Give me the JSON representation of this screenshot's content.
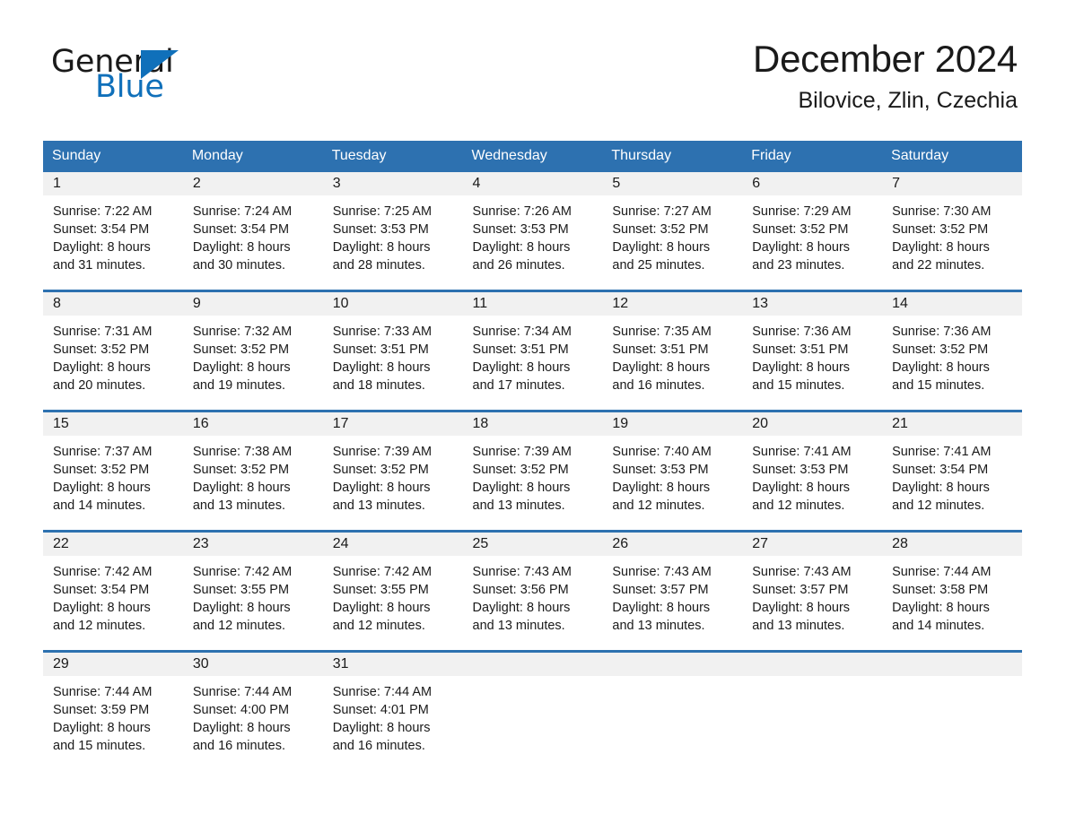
{
  "brand": {
    "name_part1": "General",
    "name_part2": "Blue",
    "accent_color": "#1070ba"
  },
  "header": {
    "month_title": "December 2024",
    "location": "Bilovice, Zlin, Czechia"
  },
  "theme": {
    "header_row_bg": "#2d71b0",
    "daynum_band_bg": "#f1f1f1",
    "row_divider": "#2d71b0",
    "text": "#1a1a1a"
  },
  "weekday_headers": [
    "Sunday",
    "Monday",
    "Tuesday",
    "Wednesday",
    "Thursday",
    "Friday",
    "Saturday"
  ],
  "weeks": [
    {
      "days": [
        {
          "date": "1",
          "sunrise": "Sunrise: 7:22 AM",
          "sunset": "Sunset: 3:54 PM",
          "daylight_line1": "Daylight: 8 hours",
          "daylight_line2": "and 31 minutes."
        },
        {
          "date": "2",
          "sunrise": "Sunrise: 7:24 AM",
          "sunset": "Sunset: 3:54 PM",
          "daylight_line1": "Daylight: 8 hours",
          "daylight_line2": "and 30 minutes."
        },
        {
          "date": "3",
          "sunrise": "Sunrise: 7:25 AM",
          "sunset": "Sunset: 3:53 PM",
          "daylight_line1": "Daylight: 8 hours",
          "daylight_line2": "and 28 minutes."
        },
        {
          "date": "4",
          "sunrise": "Sunrise: 7:26 AM",
          "sunset": "Sunset: 3:53 PM",
          "daylight_line1": "Daylight: 8 hours",
          "daylight_line2": "and 26 minutes."
        },
        {
          "date": "5",
          "sunrise": "Sunrise: 7:27 AM",
          "sunset": "Sunset: 3:52 PM",
          "daylight_line1": "Daylight: 8 hours",
          "daylight_line2": "and 25 minutes."
        },
        {
          "date": "6",
          "sunrise": "Sunrise: 7:29 AM",
          "sunset": "Sunset: 3:52 PM",
          "daylight_line1": "Daylight: 8 hours",
          "daylight_line2": "and 23 minutes."
        },
        {
          "date": "7",
          "sunrise": "Sunrise: 7:30 AM",
          "sunset": "Sunset: 3:52 PM",
          "daylight_line1": "Daylight: 8 hours",
          "daylight_line2": "and 22 minutes."
        }
      ]
    },
    {
      "days": [
        {
          "date": "8",
          "sunrise": "Sunrise: 7:31 AM",
          "sunset": "Sunset: 3:52 PM",
          "daylight_line1": "Daylight: 8 hours",
          "daylight_line2": "and 20 minutes."
        },
        {
          "date": "9",
          "sunrise": "Sunrise: 7:32 AM",
          "sunset": "Sunset: 3:52 PM",
          "daylight_line1": "Daylight: 8 hours",
          "daylight_line2": "and 19 minutes."
        },
        {
          "date": "10",
          "sunrise": "Sunrise: 7:33 AM",
          "sunset": "Sunset: 3:51 PM",
          "daylight_line1": "Daylight: 8 hours",
          "daylight_line2": "and 18 minutes."
        },
        {
          "date": "11",
          "sunrise": "Sunrise: 7:34 AM",
          "sunset": "Sunset: 3:51 PM",
          "daylight_line1": "Daylight: 8 hours",
          "daylight_line2": "and 17 minutes."
        },
        {
          "date": "12",
          "sunrise": "Sunrise: 7:35 AM",
          "sunset": "Sunset: 3:51 PM",
          "daylight_line1": "Daylight: 8 hours",
          "daylight_line2": "and 16 minutes."
        },
        {
          "date": "13",
          "sunrise": "Sunrise: 7:36 AM",
          "sunset": "Sunset: 3:51 PM",
          "daylight_line1": "Daylight: 8 hours",
          "daylight_line2": "and 15 minutes."
        },
        {
          "date": "14",
          "sunrise": "Sunrise: 7:36 AM",
          "sunset": "Sunset: 3:52 PM",
          "daylight_line1": "Daylight: 8 hours",
          "daylight_line2": "and 15 minutes."
        }
      ]
    },
    {
      "days": [
        {
          "date": "15",
          "sunrise": "Sunrise: 7:37 AM",
          "sunset": "Sunset: 3:52 PM",
          "daylight_line1": "Daylight: 8 hours",
          "daylight_line2": "and 14 minutes."
        },
        {
          "date": "16",
          "sunrise": "Sunrise: 7:38 AM",
          "sunset": "Sunset: 3:52 PM",
          "daylight_line1": "Daylight: 8 hours",
          "daylight_line2": "and 13 minutes."
        },
        {
          "date": "17",
          "sunrise": "Sunrise: 7:39 AM",
          "sunset": "Sunset: 3:52 PM",
          "daylight_line1": "Daylight: 8 hours",
          "daylight_line2": "and 13 minutes."
        },
        {
          "date": "18",
          "sunrise": "Sunrise: 7:39 AM",
          "sunset": "Sunset: 3:52 PM",
          "daylight_line1": "Daylight: 8 hours",
          "daylight_line2": "and 13 minutes."
        },
        {
          "date": "19",
          "sunrise": "Sunrise: 7:40 AM",
          "sunset": "Sunset: 3:53 PM",
          "daylight_line1": "Daylight: 8 hours",
          "daylight_line2": "and 12 minutes."
        },
        {
          "date": "20",
          "sunrise": "Sunrise: 7:41 AM",
          "sunset": "Sunset: 3:53 PM",
          "daylight_line1": "Daylight: 8 hours",
          "daylight_line2": "and 12 minutes."
        },
        {
          "date": "21",
          "sunrise": "Sunrise: 7:41 AM",
          "sunset": "Sunset: 3:54 PM",
          "daylight_line1": "Daylight: 8 hours",
          "daylight_line2": "and 12 minutes."
        }
      ]
    },
    {
      "days": [
        {
          "date": "22",
          "sunrise": "Sunrise: 7:42 AM",
          "sunset": "Sunset: 3:54 PM",
          "daylight_line1": "Daylight: 8 hours",
          "daylight_line2": "and 12 minutes."
        },
        {
          "date": "23",
          "sunrise": "Sunrise: 7:42 AM",
          "sunset": "Sunset: 3:55 PM",
          "daylight_line1": "Daylight: 8 hours",
          "daylight_line2": "and 12 minutes."
        },
        {
          "date": "24",
          "sunrise": "Sunrise: 7:42 AM",
          "sunset": "Sunset: 3:55 PM",
          "daylight_line1": "Daylight: 8 hours",
          "daylight_line2": "and 12 minutes."
        },
        {
          "date": "25",
          "sunrise": "Sunrise: 7:43 AM",
          "sunset": "Sunset: 3:56 PM",
          "daylight_line1": "Daylight: 8 hours",
          "daylight_line2": "and 13 minutes."
        },
        {
          "date": "26",
          "sunrise": "Sunrise: 7:43 AM",
          "sunset": "Sunset: 3:57 PM",
          "daylight_line1": "Daylight: 8 hours",
          "daylight_line2": "and 13 minutes."
        },
        {
          "date": "27",
          "sunrise": "Sunrise: 7:43 AM",
          "sunset": "Sunset: 3:57 PM",
          "daylight_line1": "Daylight: 8 hours",
          "daylight_line2": "and 13 minutes."
        },
        {
          "date": "28",
          "sunrise": "Sunrise: 7:44 AM",
          "sunset": "Sunset: 3:58 PM",
          "daylight_line1": "Daylight: 8 hours",
          "daylight_line2": "and 14 minutes."
        }
      ]
    },
    {
      "days": [
        {
          "date": "29",
          "sunrise": "Sunrise: 7:44 AM",
          "sunset": "Sunset: 3:59 PM",
          "daylight_line1": "Daylight: 8 hours",
          "daylight_line2": "and 15 minutes."
        },
        {
          "date": "30",
          "sunrise": "Sunrise: 7:44 AM",
          "sunset": "Sunset: 4:00 PM",
          "daylight_line1": "Daylight: 8 hours",
          "daylight_line2": "and 16 minutes."
        },
        {
          "date": "31",
          "sunrise": "Sunrise: 7:44 AM",
          "sunset": "Sunset: 4:01 PM",
          "daylight_line1": "Daylight: 8 hours",
          "daylight_line2": "and 16 minutes."
        },
        {
          "date": "",
          "sunrise": "",
          "sunset": "",
          "daylight_line1": "",
          "daylight_line2": ""
        },
        {
          "date": "",
          "sunrise": "",
          "sunset": "",
          "daylight_line1": "",
          "daylight_line2": ""
        },
        {
          "date": "",
          "sunrise": "",
          "sunset": "",
          "daylight_line1": "",
          "daylight_line2": ""
        },
        {
          "date": "",
          "sunrise": "",
          "sunset": "",
          "daylight_line1": "",
          "daylight_line2": ""
        }
      ]
    }
  ]
}
